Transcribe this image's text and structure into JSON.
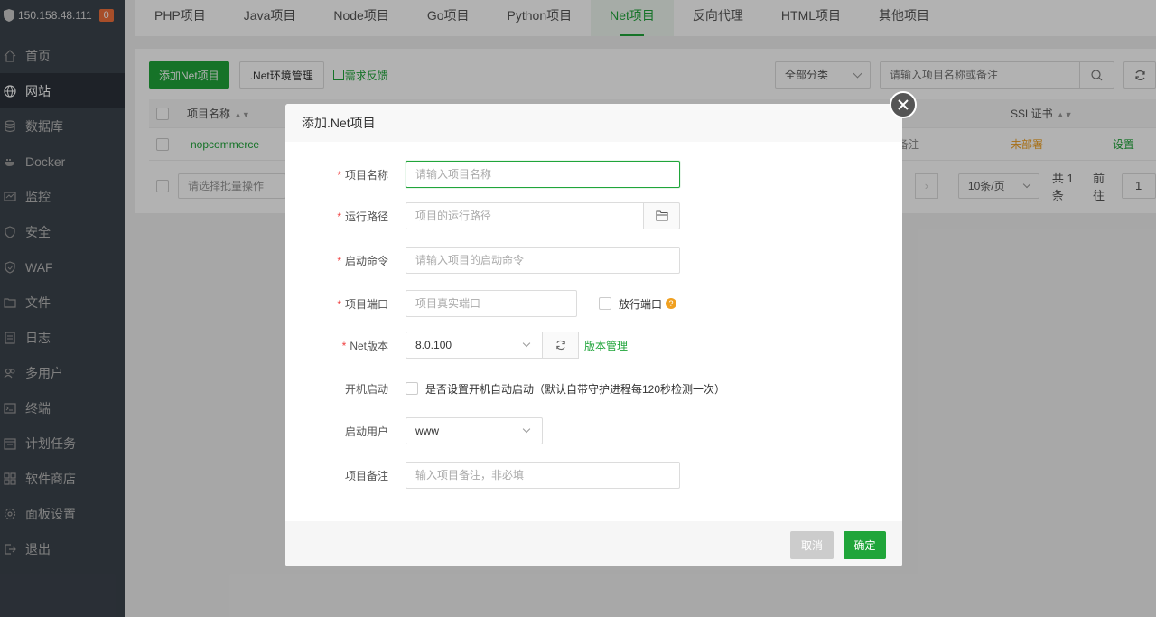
{
  "server": {
    "ip": "150.158.48.111",
    "badge": "0"
  },
  "sidebar": {
    "items": [
      {
        "label": "首页",
        "icon": "home-icon"
      },
      {
        "label": "网站",
        "icon": "globe-icon",
        "active": true
      },
      {
        "label": "数据库",
        "icon": "database-icon"
      },
      {
        "label": "Docker",
        "icon": "docker-icon"
      },
      {
        "label": "监控",
        "icon": "monitor-icon"
      },
      {
        "label": "安全",
        "icon": "shield-icon"
      },
      {
        "label": "WAF",
        "icon": "waf-icon"
      },
      {
        "label": "文件",
        "icon": "folder-icon"
      },
      {
        "label": "日志",
        "icon": "log-icon"
      },
      {
        "label": "多用户",
        "icon": "users-icon"
      },
      {
        "label": "终端",
        "icon": "terminal-icon"
      },
      {
        "label": "计划任务",
        "icon": "schedule-icon"
      },
      {
        "label": "软件商店",
        "icon": "store-icon"
      },
      {
        "label": "面板设置",
        "icon": "gear-icon"
      },
      {
        "label": "退出",
        "icon": "logout-icon"
      }
    ]
  },
  "tabs": [
    "PHP项目",
    "Java项目",
    "Node项目",
    "Go项目",
    "Python项目",
    "Net项目",
    "反向代理",
    "HTML项目",
    "其他项目"
  ],
  "active_tab": "Net项目",
  "toolbar": {
    "add_label": "添加Net项目",
    "env_label": ".Net环境管理",
    "feedback_label": "需求反馈"
  },
  "filters": {
    "category": "全部分类",
    "search_placeholder": "请输入项目名称或备注"
  },
  "table": {
    "col_name": "项目名称",
    "col_ssl": "SSL证书",
    "row": {
      "name": "nopcommerce",
      "remark": "备注",
      "ssl": "未部署",
      "action": "设置"
    },
    "batch_placeholder": "请选择批量操作"
  },
  "pager": {
    "next": "›",
    "page_size": "10条/页",
    "total": "共 1 条",
    "goto": "前往",
    "page": "1"
  },
  "modal": {
    "title": "添加.Net项目",
    "fields": {
      "name": {
        "label": "项目名称",
        "placeholder": "请输入项目名称"
      },
      "path": {
        "label": "运行路径",
        "placeholder": "项目的运行路径"
      },
      "cmd": {
        "label": "启动命令",
        "placeholder": "请输入项目的启动命令"
      },
      "port": {
        "label": "项目端口",
        "placeholder": "项目真实端口",
        "allow_label": "放行端口",
        "help": "?"
      },
      "version": {
        "label": "Net版本",
        "value": "8.0.100",
        "manage_label": "版本管理"
      },
      "autostart": {
        "label": "开机启动",
        "text": "是否设置开机自动启动（默认自带守护进程每120秒检测一次）"
      },
      "user": {
        "label": "启动用户",
        "value": "www"
      },
      "remark": {
        "label": "项目备注",
        "placeholder": "输入项目备注，非必填"
      }
    },
    "cancel_label": "取消",
    "ok_label": "确定"
  },
  "required_mark": "*",
  "colors": {
    "accent": "#20a53a",
    "sidebar_bg": "#3c444d",
    "warning": "#f0a020",
    "required": "#f04040"
  }
}
